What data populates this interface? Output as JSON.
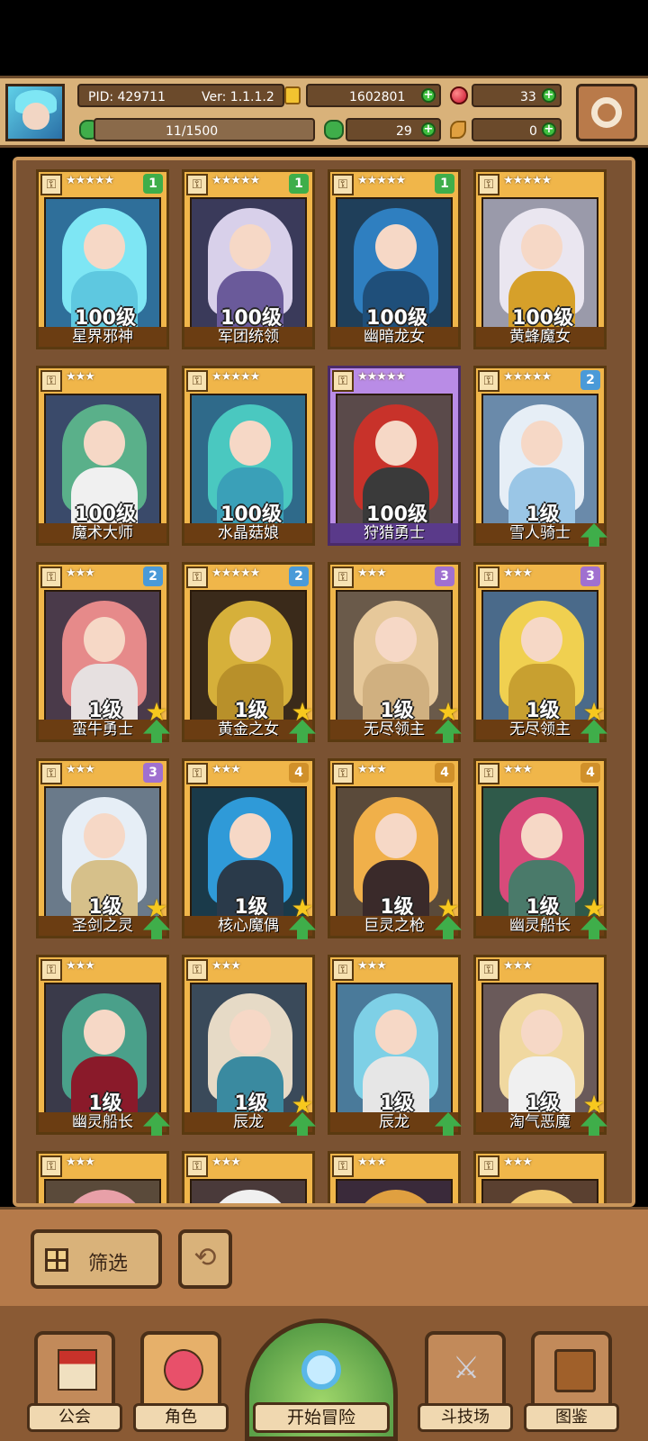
{
  "hud": {
    "pid": "PID: 429711",
    "version": "Ver: 1.1.1.2",
    "exp": "11/1500",
    "gold": "1602801",
    "gems": "33",
    "clover": "29",
    "tickets": "0"
  },
  "cards": [
    {
      "name": "星界邪神",
      "level": "100级",
      "stars": "★★★★★",
      "tier": "1",
      "tier_color": "#3fae4a",
      "hair": "#7ee6f4",
      "outfit": "#5ec8e0",
      "bg": "#2f6f9a",
      "purple": false,
      "star_badge": false
    },
    {
      "name": "军团统领",
      "level": "100级",
      "stars": "★★★★★",
      "tier": "1",
      "tier_color": "#3fae4a",
      "hair": "#d8d0ea",
      "outfit": "#6a5a9a",
      "bg": "#3a3a5a",
      "purple": false,
      "star_badge": false
    },
    {
      "name": "幽暗龙女",
      "level": "100级",
      "stars": "★★★★★",
      "tier": "1",
      "tier_color": "#3fae4a",
      "hair": "#2f7fc0",
      "outfit": "#1f4f7a",
      "bg": "#1f3f5a",
      "purple": false,
      "star_badge": false
    },
    {
      "name": "黄蜂魔女",
      "level": "100级",
      "stars": "★★★★★",
      "tier": "",
      "tier_color": "",
      "hair": "#eae6f0",
      "outfit": "#d6a02a",
      "bg": "#9a9aaa",
      "purple": false,
      "star_badge": false
    },
    {
      "name": "魔术大师",
      "level": "100级",
      "stars": "★★★",
      "tier": "",
      "tier_color": "",
      "hair": "#5ab08a",
      "outfit": "#f0f0f0",
      "bg": "#3a4a6a",
      "purple": false,
      "star_badge": false
    },
    {
      "name": "水晶菇娘",
      "level": "100级",
      "stars": "★★★★★",
      "tier": "",
      "tier_color": "",
      "hair": "#4ac8c0",
      "outfit": "#3aa0b8",
      "bg": "#2f6a8a",
      "purple": false,
      "star_badge": false
    },
    {
      "name": "狩猎勇士",
      "level": "100级",
      "stars": "★★★★★",
      "tier": "",
      "tier_color": "",
      "hair": "#c8322a",
      "outfit": "#3a3a3a",
      "bg": "#5a4a4a",
      "purple": true,
      "star_badge": false
    },
    {
      "name": "雪人骑士",
      "level": "1级",
      "stars": "★★★★★",
      "tier": "2",
      "tier_color": "#4a9ad8",
      "hair": "#e6eef6",
      "outfit": "#9ac6e6",
      "bg": "#6a8aaa",
      "purple": false,
      "star_badge": false
    },
    {
      "name": "蛮牛勇士",
      "level": "1级",
      "stars": "★★★",
      "tier": "2",
      "tier_color": "#4a9ad8",
      "hair": "#e68a8a",
      "outfit": "#e6e0e0",
      "bg": "#4a3a4a",
      "purple": false,
      "star_badge": true
    },
    {
      "name": "黄金之女",
      "level": "1级",
      "stars": "★★★★★",
      "tier": "2",
      "tier_color": "#4a9ad8",
      "hair": "#d6b03a",
      "outfit": "#b8902a",
      "bg": "#3a2a1a",
      "purple": false,
      "star_badge": true
    },
    {
      "name": "无尽领主",
      "level": "1级",
      "stars": "★★★",
      "tier": "3",
      "tier_color": "#a070d0",
      "hair": "#e6c89a",
      "outfit": "#d0b080",
      "bg": "#6a5a4a",
      "purple": false,
      "star_badge": true
    },
    {
      "name": "无尽领主",
      "level": "1级",
      "stars": "★★★",
      "tier": "3",
      "tier_color": "#a070d0",
      "hair": "#f0d050",
      "outfit": "#c8a030",
      "bg": "#4a6a8a",
      "purple": false,
      "star_badge": true
    },
    {
      "name": "圣剑之灵",
      "level": "1级",
      "stars": "★★★",
      "tier": "3",
      "tier_color": "#a070d0",
      "hair": "#e6eef6",
      "outfit": "#d6c08a",
      "bg": "#6a7a8a",
      "purple": false,
      "star_badge": true
    },
    {
      "name": "核心魔偶",
      "level": "1级",
      "stars": "★★★",
      "tier": "4",
      "tier_color": "#d0902a",
      "hair": "#2f9ad8",
      "outfit": "#2a3a4a",
      "bg": "#1a3a4a",
      "purple": false,
      "star_badge": true
    },
    {
      "name": "巨灵之枪",
      "level": "1级",
      "stars": "★★★",
      "tier": "4",
      "tier_color": "#d0902a",
      "hair": "#f0b04a",
      "outfit": "#3a2a2a",
      "bg": "#5a4a3a",
      "purple": false,
      "star_badge": true
    },
    {
      "name": "幽灵船长",
      "level": "1级",
      "stars": "★★★",
      "tier": "4",
      "tier_color": "#d0902a",
      "hair": "#d84a7a",
      "outfit": "#4a7a6a",
      "bg": "#2f5a4a",
      "purple": false,
      "star_badge": true
    },
    {
      "name": "幽灵船长",
      "level": "1级",
      "stars": "★★★",
      "tier": "",
      "tier_color": "",
      "hair": "#4aa08a",
      "outfit": "#8a1a2a",
      "bg": "#3a3a4a",
      "purple": false,
      "star_badge": false
    },
    {
      "name": "辰龙",
      "level": "1级",
      "stars": "★★★",
      "tier": "",
      "tier_color": "",
      "hair": "#e6dac6",
      "outfit": "#3a8aa0",
      "bg": "#3a4a5a",
      "purple": false,
      "star_badge": true
    },
    {
      "name": "辰龙",
      "level": "1级",
      "stars": "★★★",
      "tier": "",
      "tier_color": "",
      "hair": "#7ed0e6",
      "outfit": "#e6e6e6",
      "bg": "#4a7a9a",
      "purple": false,
      "star_badge": false
    },
    {
      "name": "淘气恶魔",
      "level": "1级",
      "stars": "★★★",
      "tier": "",
      "tier_color": "",
      "hair": "#f0d8a0",
      "outfit": "#f0f0f0",
      "bg": "#6a5a5a",
      "purple": false,
      "star_badge": true
    },
    {
      "name": "",
      "level": "",
      "stars": "★★★",
      "tier": "",
      "tier_color": "",
      "hair": "#e8a0a8",
      "outfit": "#d0a060",
      "bg": "#5a4a3a",
      "purple": false,
      "star_badge": false
    },
    {
      "name": "",
      "level": "",
      "stars": "★★★",
      "tier": "",
      "tier_color": "",
      "hair": "#f0f0f0",
      "outfit": "#c0a080",
      "bg": "#4a3a3a",
      "purple": false,
      "star_badge": false
    },
    {
      "name": "",
      "level": "",
      "stars": "★★★",
      "tier": "",
      "tier_color": "",
      "hair": "#e0a040",
      "outfit": "#b02030",
      "bg": "#3a2a3a",
      "purple": false,
      "star_badge": false
    },
    {
      "name": "",
      "level": "",
      "stars": "★★★",
      "tier": "",
      "tier_color": "",
      "hair": "#f0c870",
      "outfit": "#e0a050",
      "bg": "#5a4030",
      "purple": false,
      "star_badge": false
    }
  ],
  "controls": {
    "filter_label": "筛选",
    "reset_icon": "refresh-icon"
  },
  "nav": {
    "guild": "公会",
    "character": "角色",
    "adventure": "开始冒险",
    "arena": "斗技场",
    "codex": "图鉴"
  }
}
